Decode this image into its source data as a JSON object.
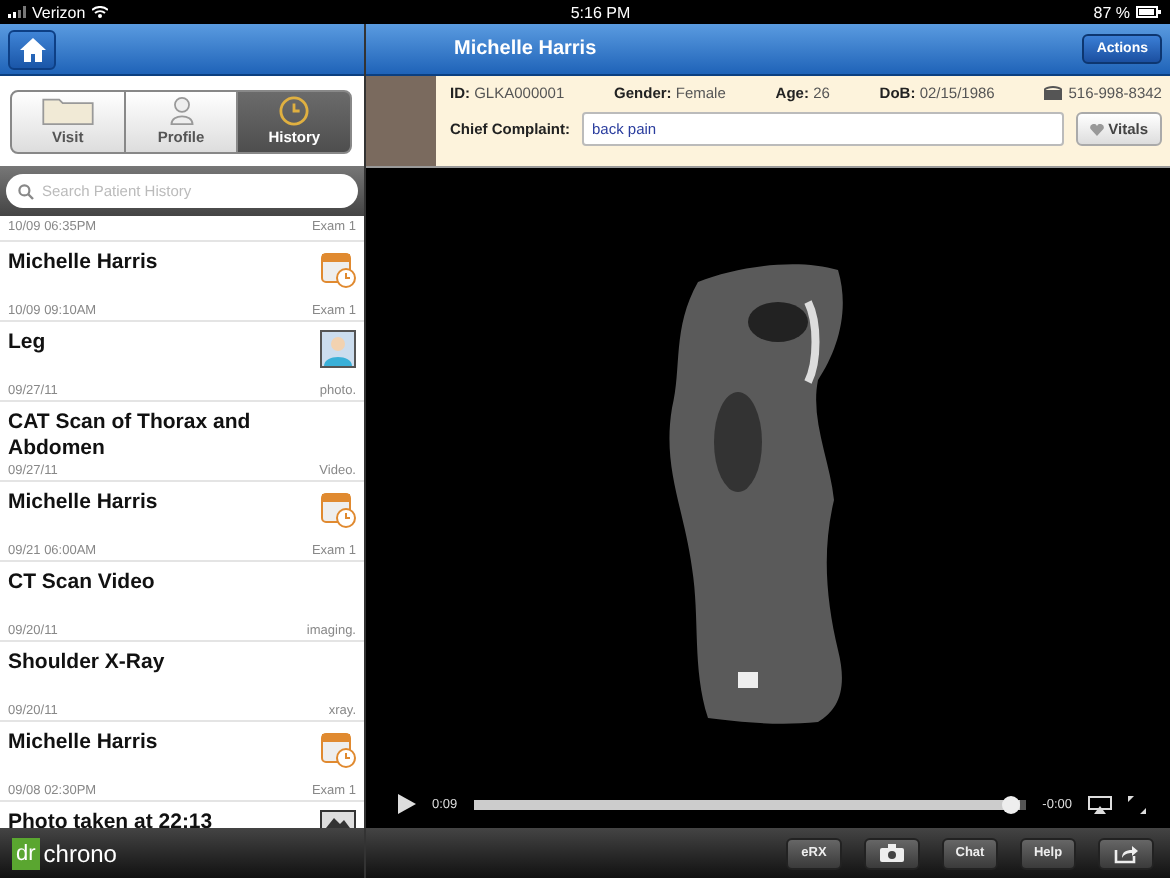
{
  "status_bar": {
    "carrier": "Verizon",
    "time": "5:16 PM",
    "battery": "87 %"
  },
  "sidebar": {
    "tabs": [
      {
        "label": "Visit",
        "kind": "folder",
        "selected": false
      },
      {
        "label": "Profile",
        "kind": "person",
        "selected": false
      },
      {
        "label": "History",
        "kind": "clock",
        "selected": true
      }
    ],
    "search": {
      "placeholder": "Search Patient History"
    },
    "history": [
      {
        "date": "10/09 06:35PM",
        "type": "Exam 1"
      },
      {
        "title": "Michelle Harris",
        "date": "10/09 09:10AM",
        "type": "Exam 1",
        "kind": "exam"
      },
      {
        "title": "Leg",
        "date": "09/27/11",
        "type": "photo.",
        "kind": "photo"
      },
      {
        "title": "CAT Scan of Thorax and Abdomen",
        "date": "09/27/11",
        "type": "Video.",
        "kind": "none"
      },
      {
        "title": "Michelle Harris",
        "date": "09/21 06:00AM",
        "type": "Exam 1",
        "kind": "exam"
      },
      {
        "title": "CT Scan Video",
        "date": "09/20/11",
        "type": "imaging.",
        "kind": "none"
      },
      {
        "title": "Shoulder X-Ray",
        "date": "09/20/11",
        "type": "xray.",
        "kind": "none"
      },
      {
        "title": "Michelle Harris",
        "date": "09/08 02:30PM",
        "type": "Exam 1",
        "kind": "exam"
      },
      {
        "title": "Photo taken at 22:13",
        "kind": "image"
      }
    ],
    "logo": {
      "mark": "dr",
      "name": "chrono"
    }
  },
  "header": {
    "title": "Michelle Harris",
    "action": "Actions"
  },
  "patient": {
    "fields": [
      {
        "label": "ID:",
        "value": "GLKA000001"
      },
      {
        "label": "Gender:",
        "value": "Female"
      },
      {
        "label": "Age:",
        "value": "26"
      },
      {
        "label": "DoB:",
        "value": "02/15/1986"
      }
    ],
    "phone": "516-998-8342",
    "complaint_label": "Chief Complaint:",
    "complaint": "back pain",
    "vitals": "Vitals"
  },
  "player": {
    "elapsed": "0:09",
    "remaining": "-0:00",
    "level": 0.99
  },
  "toolbar": [
    {
      "kind": "text",
      "label": "eRX"
    },
    {
      "kind": "camera"
    },
    {
      "kind": "text",
      "label": "Chat"
    },
    {
      "kind": "text",
      "label": "Help"
    },
    {
      "kind": "share"
    }
  ]
}
